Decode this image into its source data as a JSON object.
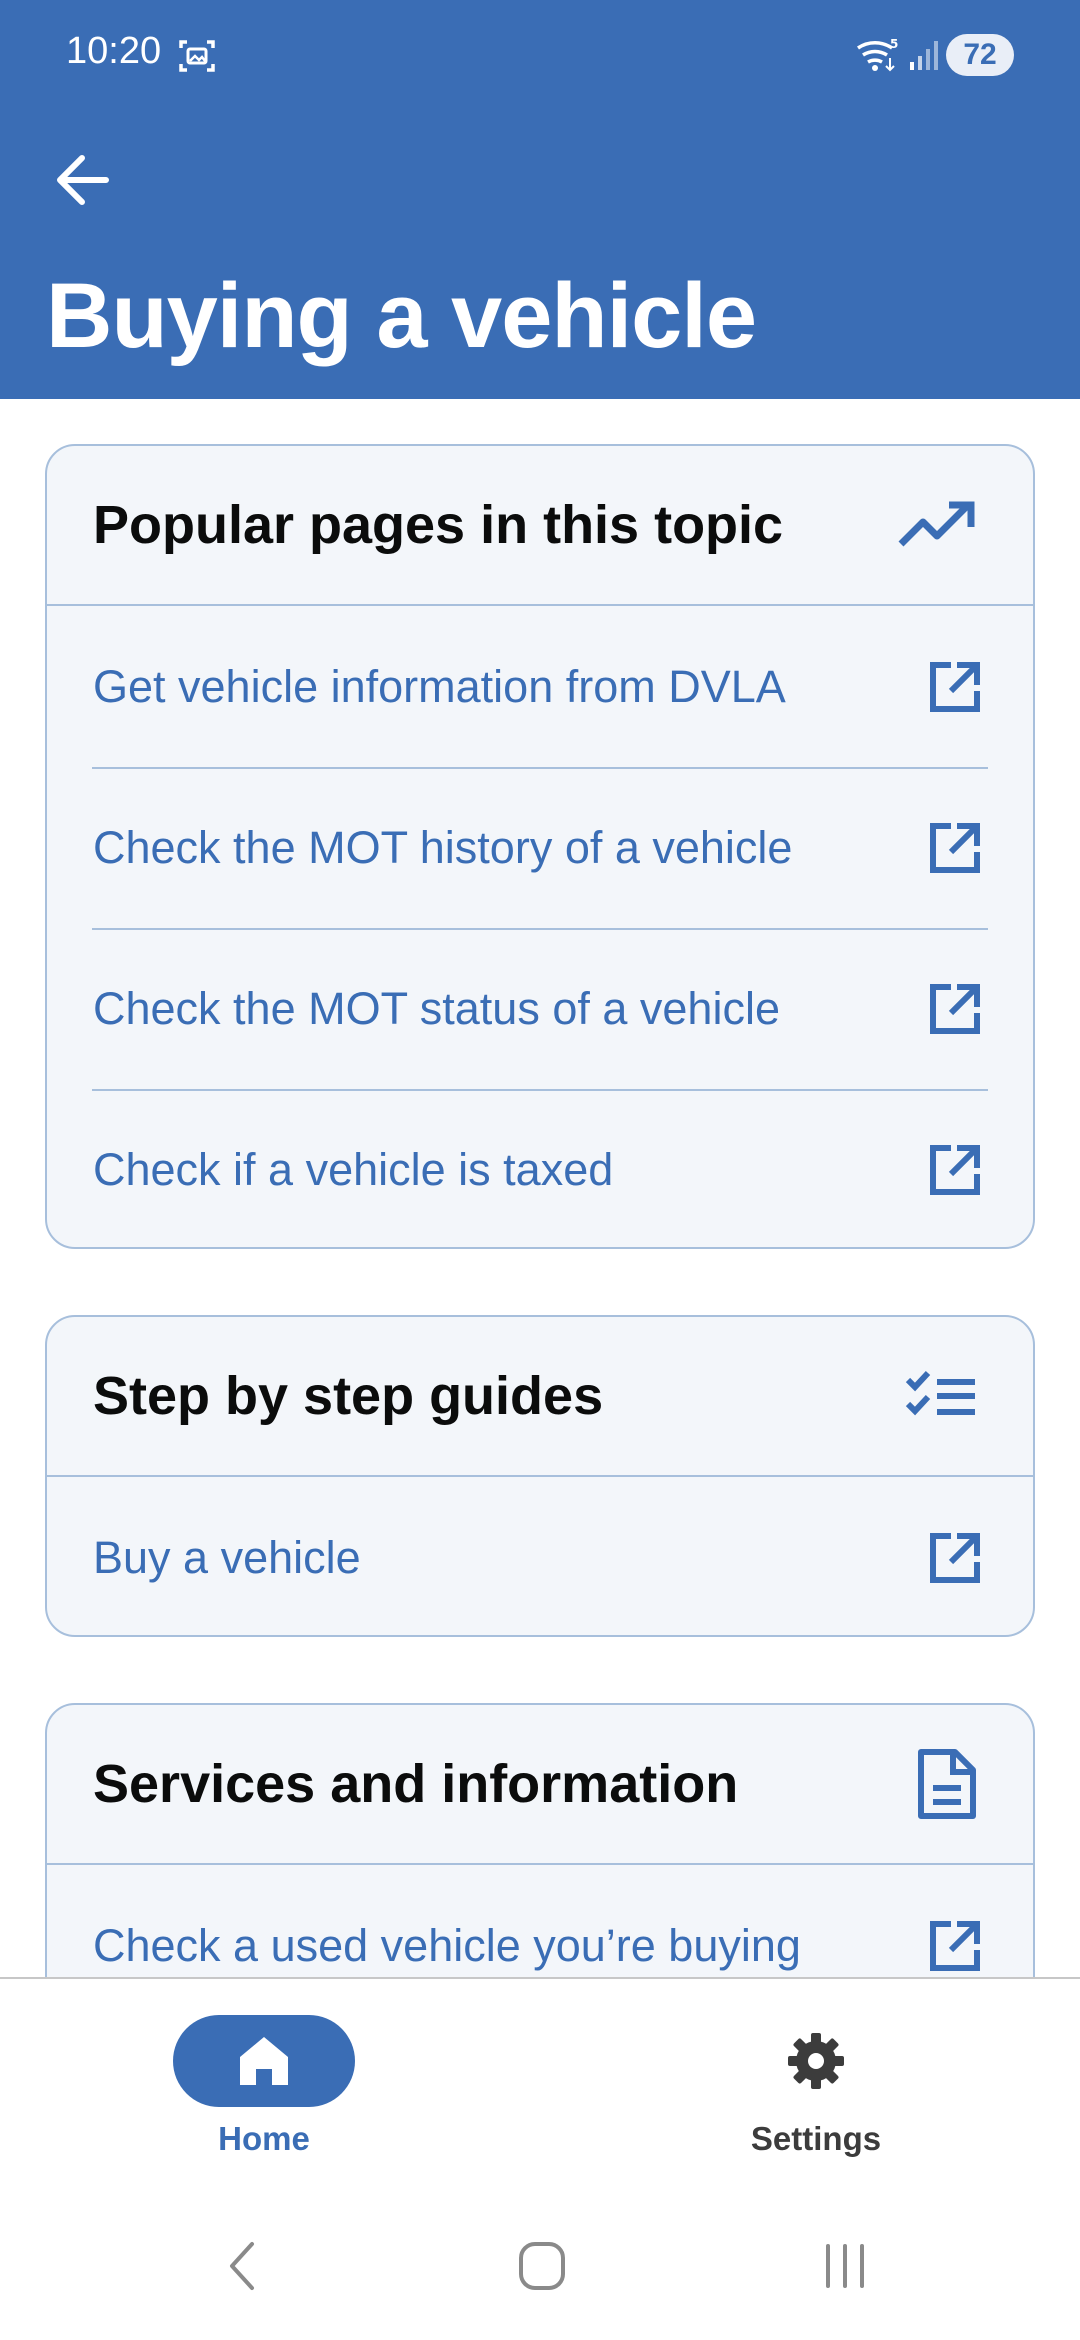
{
  "status_bar": {
    "time": "10:20",
    "battery": "72"
  },
  "header": {
    "title": "Buying a vehicle"
  },
  "sections": {
    "popular": {
      "title": "Popular pages in this topic",
      "icon": "trending-up-icon",
      "links": [
        "Get vehicle information from DVLA",
        "Check the MOT history of a vehicle",
        "Check the MOT status of a vehicle",
        "Check if a vehicle is taxed"
      ]
    },
    "step_by_step": {
      "title": "Step by step guides",
      "icon": "checklist-icon",
      "links": [
        "Buy a vehicle"
      ]
    },
    "services": {
      "title": "Services and information",
      "icon": "document-icon",
      "links": [
        "Check a used vehicle you’re buying"
      ]
    }
  },
  "bottom_nav": {
    "home_label": "Home",
    "settings_label": "Settings"
  },
  "colors": {
    "brand_blue": "#3a6db5",
    "card_background": "#f3f6fa",
    "card_border": "#a7bfdc"
  }
}
